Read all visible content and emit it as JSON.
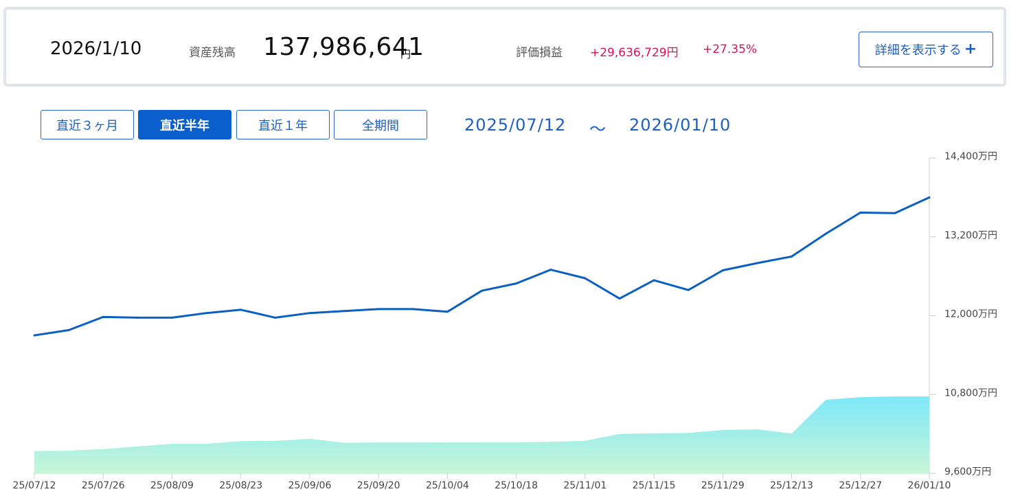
{
  "summary": {
    "date": "2026/1/10",
    "balance_label": "資産残高",
    "balance_value": "137,986,641",
    "balance_unit": "円",
    "pl_label": "評価損益",
    "pl_amount": "+29,636,729円",
    "pl_percent": "+27.35%",
    "detail_button": "詳細を表示する",
    "detail_button_icon": "plus-icon"
  },
  "period_tabs": [
    {
      "label": "直近３ヶ月",
      "active": false
    },
    {
      "label": "直近半年",
      "active": true
    },
    {
      "label": "直近１年",
      "active": false
    },
    {
      "label": "全期間",
      "active": false
    }
  ],
  "range": {
    "start": "2025/07/12",
    "separator": "～",
    "end": "2026/01/10"
  },
  "colors": {
    "accent": "#0b5fcc",
    "line": "#0a5fc4",
    "area_top": "#7ee8f8",
    "area_bottom": "#c8f5d8",
    "positive": "#d4145a"
  },
  "chart_data": {
    "type": "line",
    "x": [
      "25/07/12",
      "25/07/19",
      "25/07/26",
      "25/08/02",
      "25/08/09",
      "25/08/16",
      "25/08/23",
      "25/08/30",
      "25/09/06",
      "25/09/13",
      "25/09/20",
      "25/09/27",
      "25/10/04",
      "25/10/11",
      "25/10/18",
      "25/10/25",
      "25/11/01",
      "25/11/08",
      "25/11/15",
      "25/11/22",
      "25/11/29",
      "25/12/06",
      "25/12/13",
      "25/12/20",
      "25/12/27",
      "26/01/03",
      "26/01/10"
    ],
    "x_tick_labels": [
      "25/07/12",
      "25/07/26",
      "25/08/09",
      "25/08/23",
      "25/09/06",
      "25/09/20",
      "25/10/04",
      "25/10/18",
      "25/11/01",
      "25/11/15",
      "25/11/29",
      "25/12/13",
      "25/12/27",
      "26/01/10"
    ],
    "series": [
      {
        "kind": "line",
        "unit": "万円",
        "values": [
          11700,
          11780,
          11980,
          11970,
          11970,
          12040,
          12090,
          11970,
          12040,
          12070,
          12100,
          12100,
          12060,
          12380,
          12490,
          12700,
          12570,
          12260,
          12540,
          12390,
          12690,
          12800,
          12900,
          13250,
          13570,
          13560,
          13800
        ]
      },
      {
        "kind": "area",
        "unit": "万円",
        "values": [
          9940,
          9945,
          9970,
          10010,
          10050,
          10050,
          10090,
          10095,
          10125,
          10065,
          10070,
          10070,
          10072,
          10072,
          10074,
          10080,
          10096,
          10200,
          10210,
          10215,
          10260,
          10270,
          10205,
          10720,
          10760,
          10770,
          10770
        ]
      }
    ],
    "y_ticks": [
      9600,
      10800,
      12000,
      13200,
      14400
    ],
    "y_tick_labels": [
      "9,600万円",
      "10,800万円",
      "12,000万円",
      "13,200万円",
      "14,400万円"
    ],
    "ylim": [
      9600,
      14400
    ],
    "grid": false,
    "legend": "none"
  }
}
